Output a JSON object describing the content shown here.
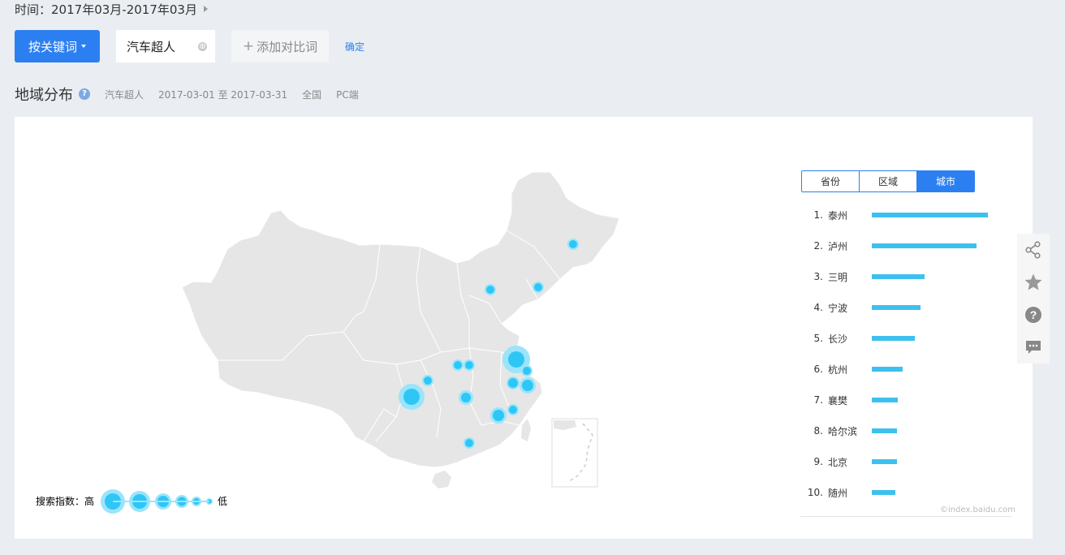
{
  "time_filter": {
    "label": "时间：",
    "value": "2017年03月-2017年03月"
  },
  "toolbar": {
    "keyword_button": "按关键词",
    "keyword_value": "汽车超人",
    "clear_icon": "⊕",
    "add_compare_plus": "+",
    "add_compare_label": "添加对比词",
    "confirm_label": "确定"
  },
  "section": {
    "title": "地域分布",
    "help_icon": "?",
    "keyword": "汽车超人",
    "date_range": "2017-03-01 至 2017-03-31",
    "region": "全国",
    "device": "PC端"
  },
  "legend": {
    "label": "搜索指数：高",
    "low": "低"
  },
  "tabs": [
    {
      "label": "省份",
      "active": false
    },
    {
      "label": "区域",
      "active": false
    },
    {
      "label": "城市",
      "active": true
    }
  ],
  "ranking": [
    {
      "rank": "1.",
      "city": "泰州",
      "value": 1.0
    },
    {
      "rank": "2.",
      "city": "泸州",
      "value": 0.9
    },
    {
      "rank": "3.",
      "city": "三明",
      "value": 0.455
    },
    {
      "rank": "4.",
      "city": "宁波",
      "value": 0.42
    },
    {
      "rank": "5.",
      "city": "长沙",
      "value": 0.37
    },
    {
      "rank": "6.",
      "city": "杭州",
      "value": 0.265
    },
    {
      "rank": "7.",
      "city": "襄樊",
      "value": 0.225
    },
    {
      "rank": "8.",
      "city": "哈尔滨",
      "value": 0.215
    },
    {
      "rank": "9.",
      "city": "北京",
      "value": 0.215
    },
    {
      "rank": "10.",
      "city": "随州",
      "value": 0.205
    }
  ],
  "watermark": "©index.baidu.com",
  "side_tools": [
    "share-icon",
    "star-icon",
    "help-icon",
    "comment-icon"
  ],
  "colors": {
    "accent": "#2c7ff0",
    "bar": "#3ec0ee",
    "bubble": "#2ec7f5"
  }
}
